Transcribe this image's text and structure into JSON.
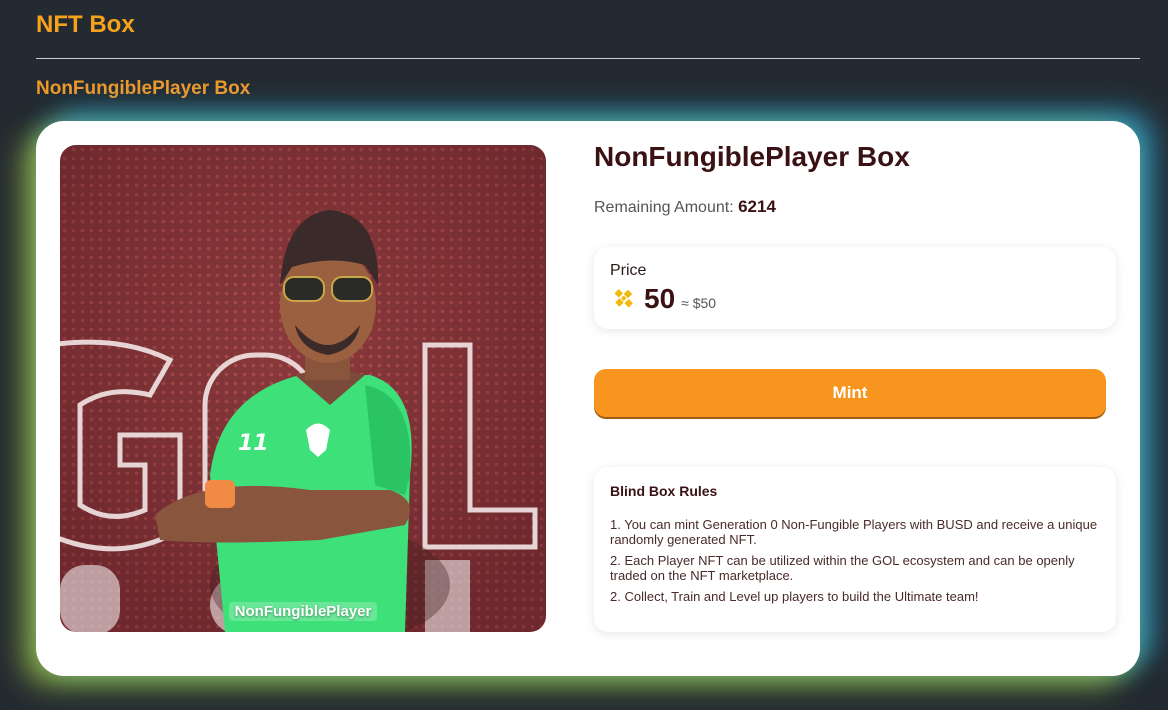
{
  "header": {
    "title": "NFT Box"
  },
  "section": {
    "title": "NonFungiblePlayer Box"
  },
  "card": {
    "image_caption": "NonFungiblePlayer",
    "title": "NonFungiblePlayer Box",
    "remaining_label": "Remaining Amount:",
    "remaining_value": "6214",
    "price": {
      "label": "Price",
      "token_icon": "bnb-icon",
      "value": "50",
      "usd": "≈ $50"
    },
    "mint_label": "Mint",
    "rules": {
      "title": "Blind Box Rules",
      "items": [
        "1. You can mint Generation 0 Non-Fungible Players with BUSD and receive a unique randomly generated NFT.",
        "2. Each Player NFT can be utilized within the GOL ecosystem and can be openly traded on the NFT marketplace.",
        "2. Collect, Train and Level up players to build the Ultimate team!"
      ]
    }
  },
  "colors": {
    "background": "#232a31",
    "accent": "#f7a21b",
    "button": "#f7951f",
    "title_text": "#3a1214"
  }
}
